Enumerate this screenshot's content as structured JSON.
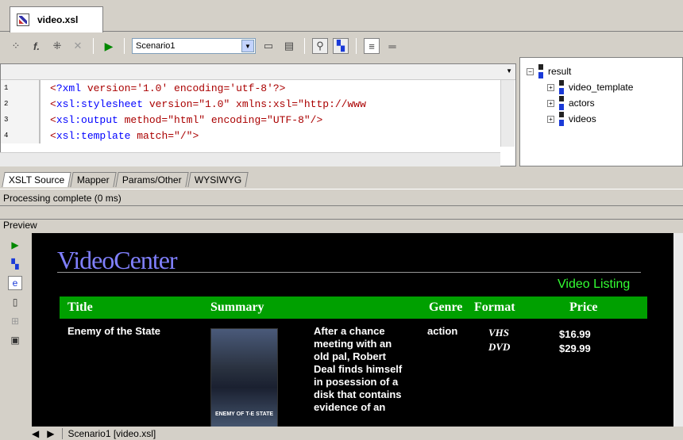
{
  "doc_tab": {
    "title": "video.xsl"
  },
  "toolbar": {
    "scenario": "Scenario1"
  },
  "editor": {
    "lines": [
      {
        "num": "1",
        "pre": "<",
        "kw": "?xml",
        "rest": " version='1.0' encoding='utf-8'?>"
      },
      {
        "num": "2",
        "pre": "<",
        "kw": "xsl:stylesheet",
        "rest": " version=\"1.0\" xmlns:xsl=\"http://www"
      },
      {
        "num": "3",
        "pre": "<",
        "kw": "xsl:output",
        "rest": " method=\"html\" encoding=\"UTF-8\"/>"
      },
      {
        "num": "4",
        "pre": "<",
        "kw": "xsl:template",
        "rest": " match=\"/\">"
      }
    ]
  },
  "tree": {
    "root": "result",
    "children": [
      "video_template",
      "actors",
      "videos"
    ]
  },
  "view_tabs": [
    "XSLT Source",
    "Mapper",
    "Params/Other",
    "WYSIWYG"
  ],
  "status": {
    "text": "Processing complete  (0 ms)"
  },
  "preview": {
    "header": "Preview",
    "logo": "VideoCenter",
    "listing": "Video Listing",
    "columns": {
      "title": "Title",
      "summary": "Summary",
      "genre": "Genre",
      "format": "Format",
      "price": "Price"
    },
    "row": {
      "title": "Enemy of the State",
      "summary": "After a chance meeting with an old pal, Robert Deal finds himself in posession of a disk that contains evidence of an",
      "genre": "action",
      "formats": [
        "VHS",
        "DVD"
      ],
      "prices": [
        "$16.99",
        "$29.99"
      ],
      "poster_label": "ENEMY OF T-E STATE"
    }
  },
  "bottom_tabs": {
    "scenario_tab": "Scenario1 [video.xsl]"
  }
}
